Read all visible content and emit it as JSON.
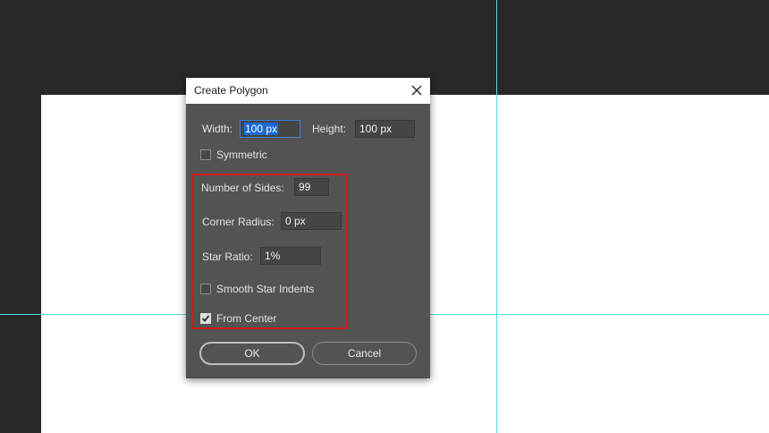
{
  "dialog": {
    "title": "Create Polygon",
    "width_label": "Width:",
    "width_value": "100 px",
    "height_label": "Height:",
    "height_value": "100 px",
    "symmetric_label": "Symmetric",
    "symmetric_checked": false,
    "sides_label": "Number of Sides:",
    "sides_value": "99",
    "corner_label": "Corner Radius:",
    "corner_value": "0 px",
    "star_label": "Star Ratio:",
    "star_value": "1%",
    "smooth_label": "Smooth Star Indents",
    "smooth_checked": false,
    "center_label": "From Center",
    "center_checked": true,
    "ok_label": "OK",
    "cancel_label": "Cancel"
  },
  "icons": {
    "close": "close-icon",
    "check": "checkmark-icon"
  },
  "colors": {
    "workspace": "#282828",
    "canvas": "#ffffff",
    "guide": "#4fe0e8",
    "dialog_bg": "#535353",
    "highlight": "#d11a1a",
    "selection": "#1c69d4"
  }
}
